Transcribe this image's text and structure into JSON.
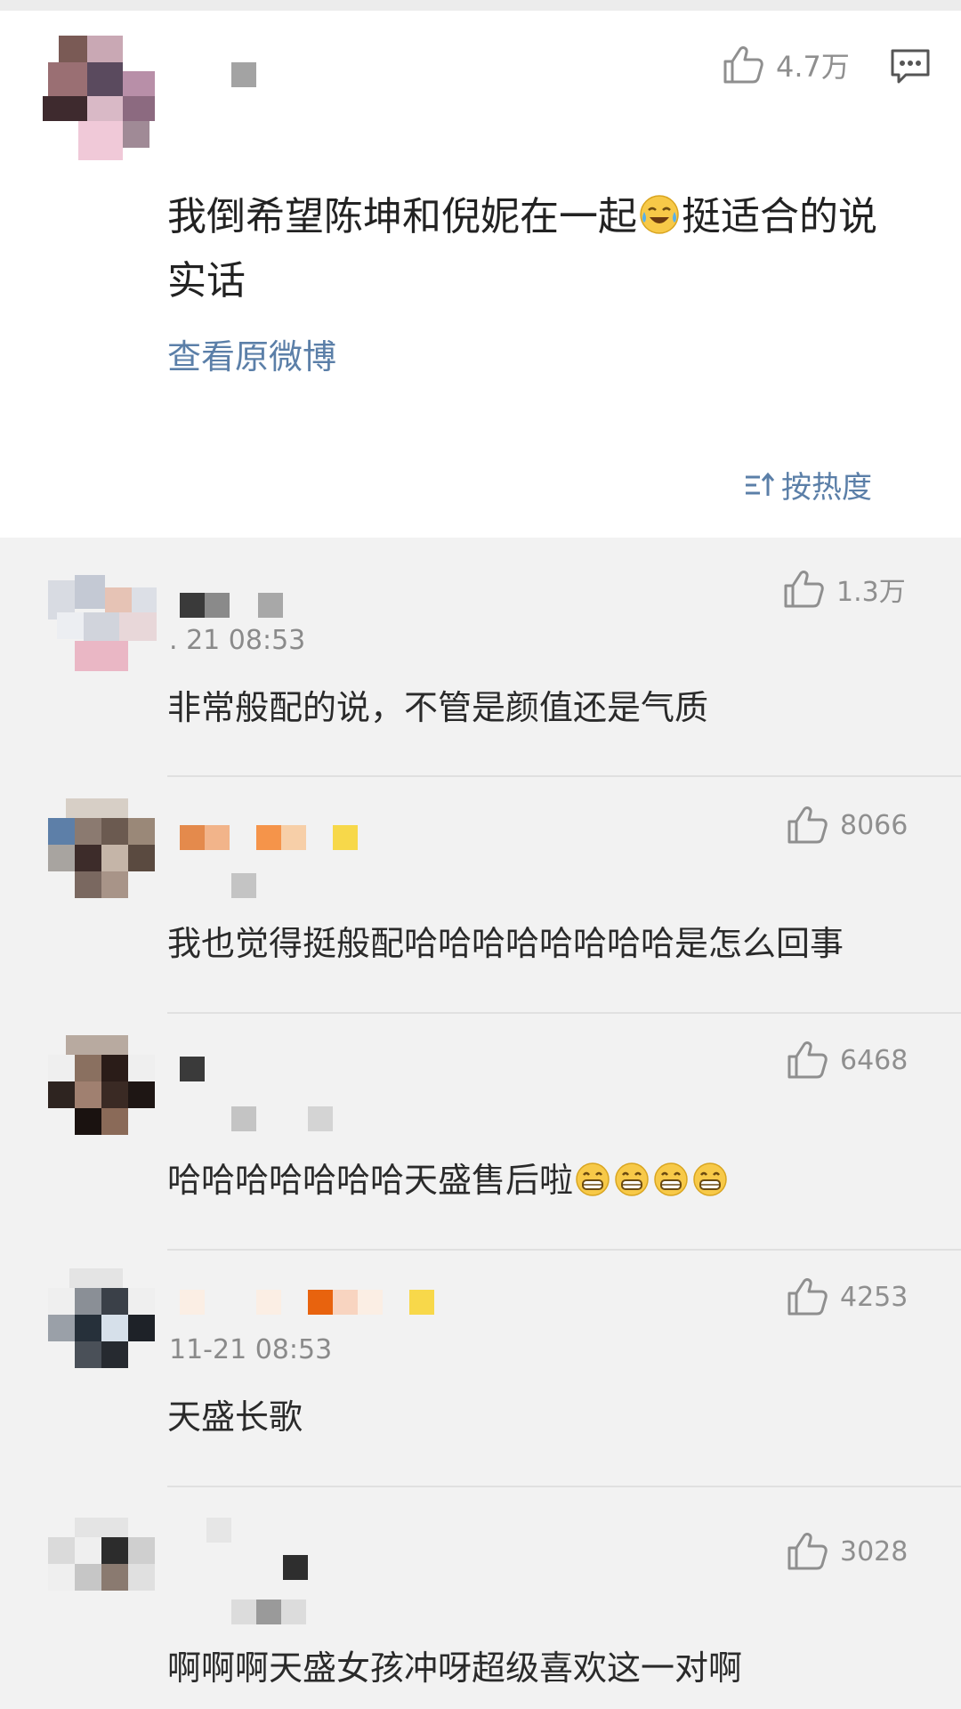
{
  "main_comment": {
    "like_count": "4.7万",
    "text_before_emoji": "我倒希望陈坤和倪妮在一起",
    "text_after_emoji": "挺适合的说实话",
    "emoji": "crying-laughing-emoji",
    "view_original": "查看原微博"
  },
  "sort": {
    "label": "按热度",
    "icon": "sort-icon"
  },
  "replies": [
    {
      "likes": "1.3万",
      "time": ". 21 08:53",
      "text": "非常般配的说，不管是颜值还是气质"
    },
    {
      "likes": "8066",
      "time": "",
      "text": "我也觉得挺般配哈哈哈哈哈哈哈哈是怎么回事"
    },
    {
      "likes": "6468",
      "time": "",
      "text": "哈哈哈哈哈哈哈天盛售后啦",
      "emoji_count": 4,
      "emoji": "grinning-emoji"
    },
    {
      "likes": "4253",
      "time": "11-21 08:53",
      "text": "天盛长歌"
    },
    {
      "likes": "3028",
      "time": "",
      "text": "啊啊啊天盛女孩冲呀超级喜欢这一对啊"
    }
  ],
  "colors": {
    "link": "#5b7fa8",
    "background": "#f2f2f2",
    "card": "#ffffff",
    "icon_gray": "#8f8f8f"
  }
}
